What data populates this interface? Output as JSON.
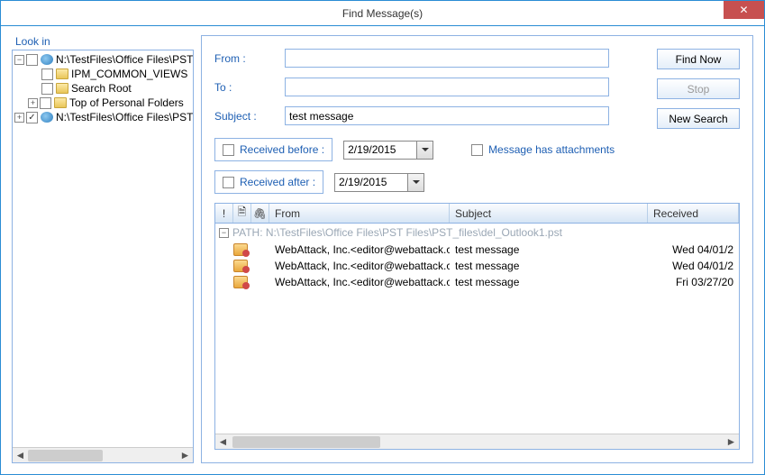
{
  "window": {
    "title": "Find Message(s)"
  },
  "lookin_label": "Look in",
  "tree": {
    "nodes": [
      {
        "level": 0,
        "toggle": "−",
        "checked": false,
        "icon": "globe",
        "label": "N:\\TestFiles\\Office Files\\PST"
      },
      {
        "level": 1,
        "toggle": "",
        "checked": false,
        "icon": "folder",
        "label": "IPM_COMMON_VIEWS"
      },
      {
        "level": 1,
        "toggle": "",
        "checked": false,
        "icon": "folder",
        "label": "Search Root"
      },
      {
        "level": 1,
        "toggle": "+",
        "checked": false,
        "icon": "folder",
        "label": "Top of Personal Folders"
      },
      {
        "level": 0,
        "toggle": "+",
        "checked": true,
        "icon": "globe",
        "label": "N:\\TestFiles\\Office Files\\PST"
      }
    ]
  },
  "form": {
    "from_label": "From :",
    "from_value": "",
    "to_label": "To :",
    "to_value": "",
    "subject_label": "Subject :",
    "subject_value": "test message",
    "received_before_label": "Received before :",
    "received_before_value": "2/19/2015",
    "received_after_label": "Received after :",
    "received_after_value": "2/19/2015",
    "attachments_label": "Message has attachments"
  },
  "buttons": {
    "find_now": "Find Now",
    "stop": "Stop",
    "new_search": "New Search"
  },
  "grid": {
    "headers": {
      "flag": "!",
      "icon": "",
      "attach": "",
      "from": "From",
      "subject": "Subject",
      "received": "Received"
    },
    "path_prefix": "PATH:  ",
    "path": "N:\\TestFiles\\Office Files\\PST Files\\PST_files\\del_Outlook1.pst",
    "rows": [
      {
        "from": "WebAttack, Inc.<editor@webattack.c...",
        "subject": "test message",
        "received": "Wed 04/01/2"
      },
      {
        "from": "WebAttack, Inc.<editor@webattack.c...",
        "subject": "test message",
        "received": "Wed 04/01/2"
      },
      {
        "from": "WebAttack, Inc.<editor@webattack.c...",
        "subject": "test message",
        "received": "Fri 03/27/20"
      }
    ]
  },
  "icons": {
    "paperclip": "📎",
    "page": "🗎"
  }
}
